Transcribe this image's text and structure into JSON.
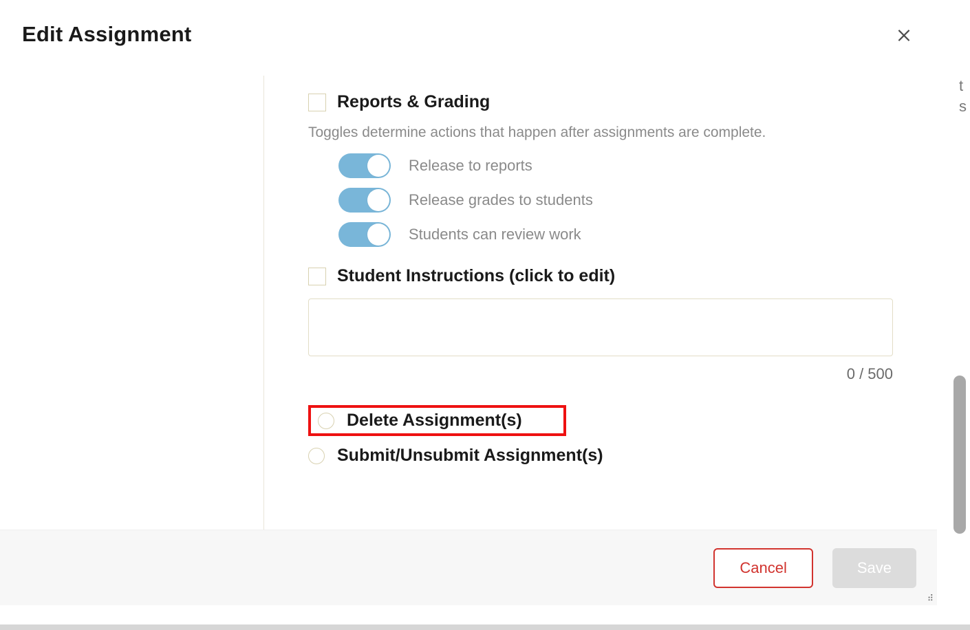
{
  "header": {
    "title": "Edit Assignment"
  },
  "reports": {
    "title": "Reports & Grading",
    "subtitle": "Toggles determine actions that happen after assignments are complete.",
    "toggles": [
      {
        "label": "Release to reports",
        "on": true
      },
      {
        "label": "Release grades to students",
        "on": true
      },
      {
        "label": "Students can review work",
        "on": true
      }
    ]
  },
  "instructions": {
    "title": "Student Instructions (click to edit)",
    "value": "",
    "counter": "0 / 500"
  },
  "actions": {
    "delete_label": "Delete Assignment(s)",
    "submit_label": "Submit/Unsubmit Assignment(s)"
  },
  "footer": {
    "cancel": "Cancel",
    "save": "Save"
  }
}
